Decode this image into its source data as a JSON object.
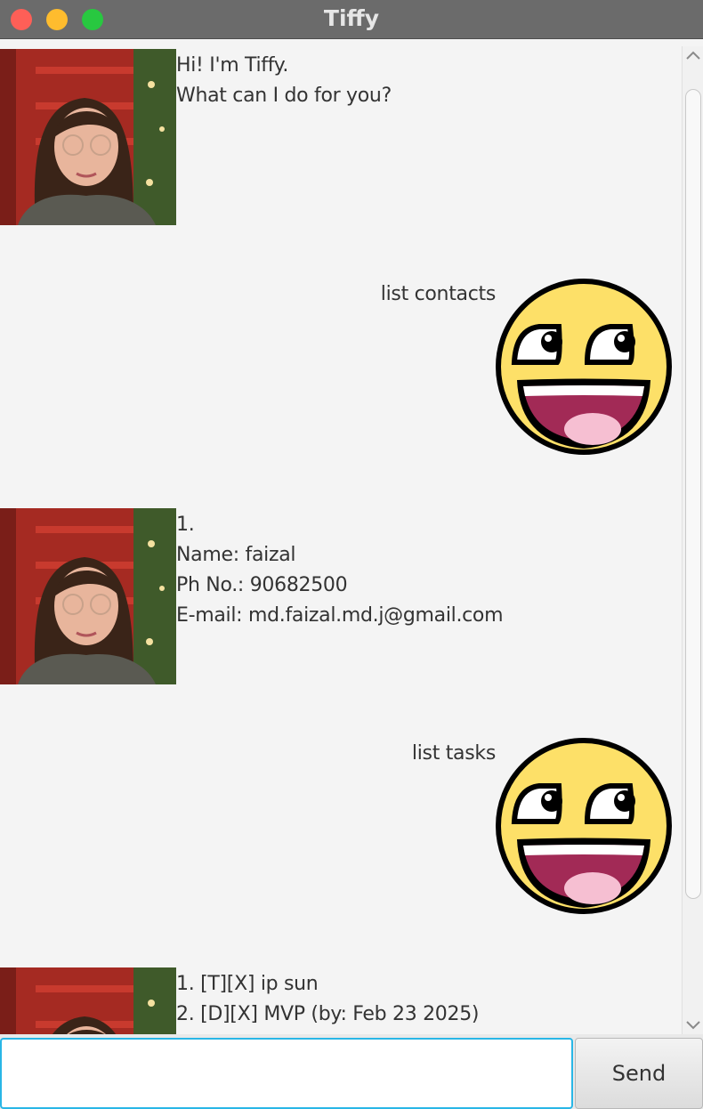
{
  "window": {
    "title": "Tiffy"
  },
  "messages": [
    {
      "sender": "bot",
      "lines": "Hi! I'm Tiffy.\nWhat can I do for you?"
    },
    {
      "sender": "user",
      "lines": "list contacts"
    },
    {
      "sender": "bot",
      "lines": "1.\nName: faizal\nPh No.: 90682500\nE-mail: md.faizal.md.j@gmail.com"
    },
    {
      "sender": "user",
      "lines": "list tasks"
    },
    {
      "sender": "bot",
      "lines": "1. [T][X] ip sun\n2. [D][X] MVP (by: Feb 23 2025)"
    }
  ],
  "input": {
    "value": "",
    "placeholder": ""
  },
  "send": {
    "label": "Send"
  },
  "icons": {
    "scroll_up": "chevron-up-icon",
    "scroll_down": "chevron-down-icon",
    "user_avatar": "smiley-face-icon"
  },
  "colors": {
    "input_focus": "#29b6e6",
    "smiley_yellow": "#fde068",
    "titlebar": "#6b6b6b"
  }
}
